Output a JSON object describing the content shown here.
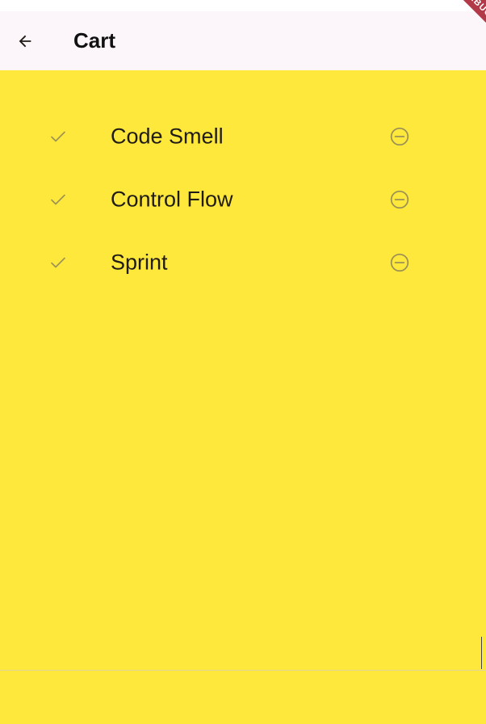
{
  "app_bar": {
    "title": "Cart",
    "back_icon": "arrow-back-icon"
  },
  "debug_banner": {
    "label": "DEBUG"
  },
  "cart": {
    "items": [
      {
        "name": "Code Smell",
        "status_icon": "check-icon",
        "action_icon": "remove-circle-outline-icon"
      },
      {
        "name": "Control Flow",
        "status_icon": "check-icon",
        "action_icon": "remove-circle-outline-icon"
      },
      {
        "name": "Sprint",
        "status_icon": "check-icon",
        "action_icon": "remove-circle-outline-icon"
      }
    ]
  },
  "colors": {
    "background": "#ffe83c",
    "app_bar": "#fcf6fb",
    "icon": "#9c9155",
    "text": "#1f1b16",
    "debug_banner": "#b23a48"
  }
}
